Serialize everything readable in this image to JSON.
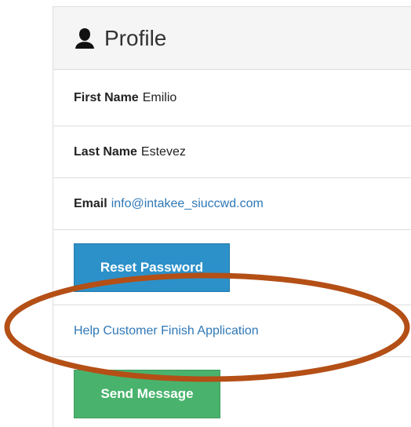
{
  "panel": {
    "title": "Profile",
    "icon": "user-icon"
  },
  "profile": {
    "first_name": {
      "label": "First Name",
      "value": "Emilio"
    },
    "last_name": {
      "label": "Last Name",
      "value": "Estevez"
    },
    "email": {
      "label": "Email",
      "value": "info@intakee_siuccwd.com"
    }
  },
  "actions": {
    "reset_password": "Reset Password",
    "help_customer": "Help Customer Finish Application",
    "send_message": "Send Message"
  },
  "colors": {
    "primary_button": "#2c91c9",
    "success_button": "#49b36d",
    "link": "#2f78b7",
    "annotation": "#b44f16"
  }
}
